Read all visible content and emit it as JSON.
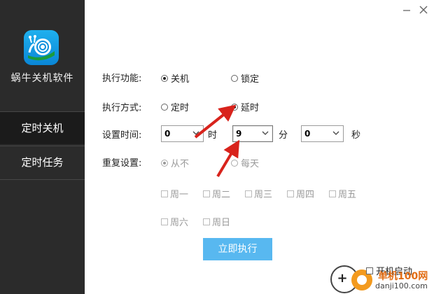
{
  "sidebar": {
    "app_name": "蜗牛关机软件",
    "items": [
      {
        "label": "定时关机"
      },
      {
        "label": "定时任务"
      }
    ]
  },
  "window": {
    "minimize_icon": "minimize-icon",
    "close_icon": "close-icon"
  },
  "form": {
    "function_label": "执行功能:",
    "function_options": [
      "关机",
      "锁定"
    ],
    "function_selected": "关机",
    "method_label": "执行方式:",
    "method_options": [
      "定时",
      "延时"
    ],
    "method_selected": "延时",
    "time_label": "设置时间:",
    "hour_value": "0",
    "hour_unit": "时",
    "minute_value": "9",
    "minute_unit": "分",
    "second_value": "0",
    "second_unit": "秒",
    "repeat_label": "重复设置:",
    "repeat_options": [
      "从不",
      "每天"
    ],
    "repeat_selected": "从不",
    "weekdays": [
      "周一",
      "周二",
      "周三",
      "周四",
      "周五",
      "周六",
      "周日"
    ],
    "run_button": "立即执行",
    "startup_label": "开机启动"
  },
  "watermark": {
    "text_cn": "单机100网",
    "text_en": "danji100.com"
  },
  "colors": {
    "sidebar_bg": "#2b2b2b",
    "sidebar_active": "#1b1b1b",
    "button_blue": "#58b8f0",
    "arrow_red": "#d8231c"
  }
}
